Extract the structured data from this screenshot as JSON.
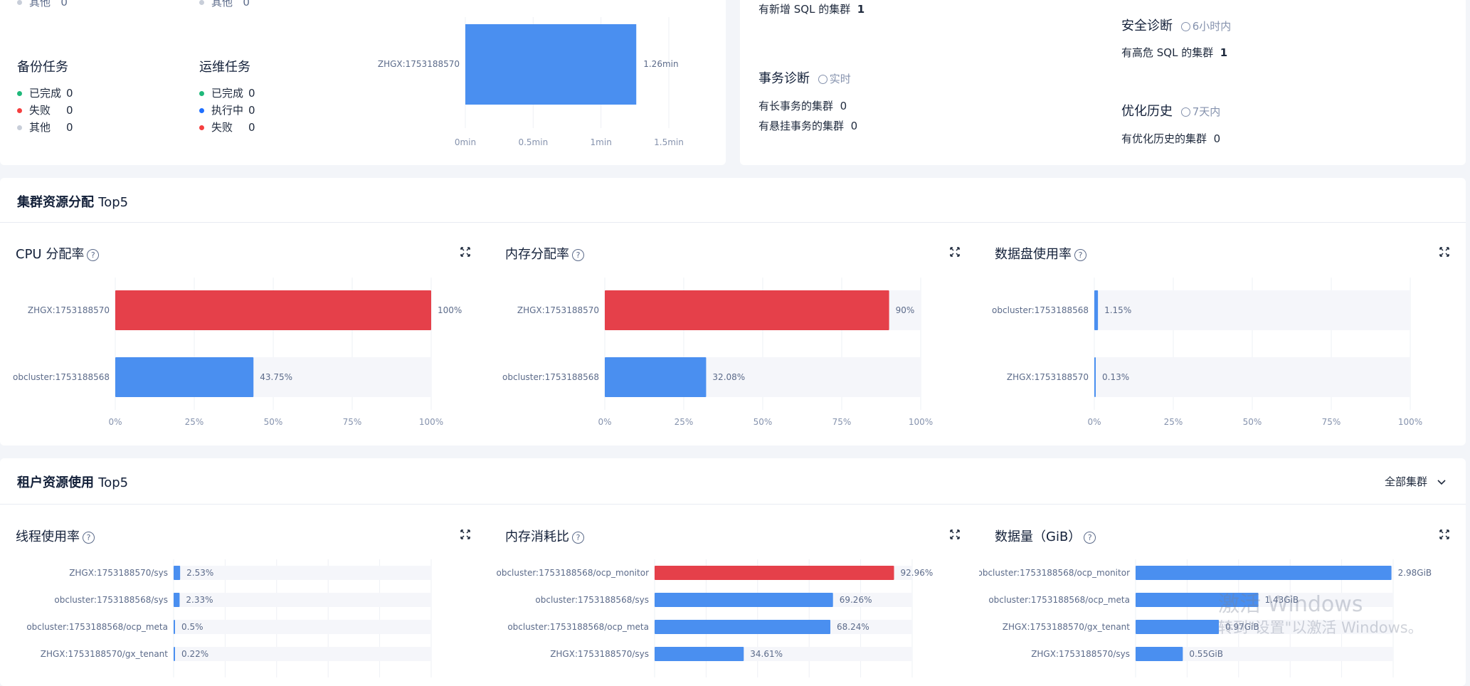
{
  "top_left": {
    "backup": {
      "title": "备份任务",
      "items": [
        {
          "label": "已完成",
          "value": "0",
          "color": "#1fb87a"
        },
        {
          "label": "失败",
          "value": "0",
          "color": "#f53f3f"
        },
        {
          "label": "其他",
          "value": "0",
          "color": "#c8ced9"
        }
      ]
    },
    "ops": {
      "title": "运维任务",
      "items": [
        {
          "label": "已完成",
          "value": "0",
          "color": "#1fb87a"
        },
        {
          "label": "执行中",
          "value": "0",
          "color": "#1f6fff"
        },
        {
          "label": "失败",
          "value": "0",
          "color": "#f53f3f"
        }
      ]
    },
    "cut_top": [
      {
        "label": "其他",
        "value": "0"
      },
      {
        "label": "其他",
        "value": "0"
      }
    ],
    "duration_chart": {
      "category": "ZHGX:1753188570",
      "value_label": "1.26min",
      "ticks": [
        "0min",
        "0.5min",
        "1min",
        "1.5min"
      ]
    }
  },
  "top_right": {
    "new_sql": {
      "label": "有新增 SQL 的集群",
      "value": "1"
    },
    "security": {
      "title": "安全诊断",
      "time": "6小时内",
      "label": "有高危 SQL 的集群",
      "value": "1"
    },
    "transaction": {
      "title": "事务诊断",
      "time": "实时",
      "items": [
        {
          "label": "有长事务的集群",
          "value": "0"
        },
        {
          "label": "有悬挂事务的集群",
          "value": "0"
        }
      ]
    },
    "optimize": {
      "title": "优化历史",
      "time": "7天内",
      "label": "有优化历史的集群",
      "value": "0"
    }
  },
  "cluster_section": {
    "title_bold": "集群资源分配",
    "title_thin": "Top5"
  },
  "tenant_section": {
    "title_bold": "租户资源使用",
    "title_thin": "Top5",
    "filter": "全部集群"
  },
  "colors": {
    "red": "#e5404a",
    "blue": "#4a8ff0",
    "track": "#f5f6fa"
  },
  "cluster_charts": [
    {
      "title": "CPU 分配率",
      "ticks": [
        "0%",
        "25%",
        "50%",
        "75%",
        "100%"
      ]
    },
    {
      "title": "内存分配率",
      "ticks": [
        "0%",
        "25%",
        "50%",
        "75%",
        "100%"
      ]
    },
    {
      "title": "数据盘使用率",
      "ticks": [
        "0%",
        "25%",
        "50%",
        "75%",
        "100%"
      ]
    }
  ],
  "tenant_charts": [
    {
      "title": "线程使用率"
    },
    {
      "title": "内存消耗比"
    },
    {
      "title": "数据量（GiB）"
    }
  ],
  "chart_data": [
    {
      "type": "bar",
      "orientation": "horizontal",
      "categories": [
        "ZHGX:1753188570"
      ],
      "values": [
        1.26
      ],
      "xlim": [
        0,
        1.5
      ]
    },
    {
      "type": "bar",
      "orientation": "horizontal",
      "title": "CPU 分配率",
      "categories": [
        "ZHGX:1753188570",
        "obcluster:1753188568"
      ],
      "values": [
        100,
        43.75
      ],
      "labels": [
        "100%",
        "43.75%"
      ],
      "xlim": [
        0,
        100
      ]
    },
    {
      "type": "bar",
      "orientation": "horizontal",
      "title": "内存分配率",
      "categories": [
        "ZHGX:1753188570",
        "obcluster:1753188568"
      ],
      "values": [
        90,
        32.08
      ],
      "labels": [
        "90%",
        "32.08%"
      ],
      "xlim": [
        0,
        100
      ]
    },
    {
      "type": "bar",
      "orientation": "horizontal",
      "title": "数据盘使用率",
      "categories": [
        "obcluster:1753188568",
        "ZHGX:1753188570"
      ],
      "values": [
        1.15,
        0.13
      ],
      "labels": [
        "1.15%",
        "0.13%"
      ],
      "xlim": [
        0,
        100
      ]
    },
    {
      "type": "bar",
      "orientation": "horizontal",
      "title": "线程使用率",
      "categories": [
        "ZHGX:1753188570/sys",
        "obcluster:1753188568/sys",
        "obcluster:1753188568/ocp_meta",
        "ZHGX:1753188570/gx_tenant"
      ],
      "values": [
        2.53,
        2.33,
        0.5,
        0.22
      ],
      "labels": [
        "2.53%",
        "2.33%",
        "0.5%",
        "0.22%"
      ],
      "xlim": [
        0,
        100
      ]
    },
    {
      "type": "bar",
      "orientation": "horizontal",
      "title": "内存消耗比",
      "categories": [
        "obcluster:1753188568/ocp_monitor",
        "obcluster:1753188568/sys",
        "obcluster:1753188568/ocp_meta",
        "ZHGX:1753188570/sys"
      ],
      "values": [
        92.96,
        69.26,
        68.24,
        34.61
      ],
      "labels": [
        "92.96%",
        "69.26%",
        "68.24%",
        "34.61%"
      ],
      "xlim": [
        0,
        100
      ]
    },
    {
      "type": "bar",
      "orientation": "horizontal",
      "title": "数据量（GiB）",
      "categories": [
        "obcluster:1753188568/ocp_monitor",
        "obcluster:1753188568/ocp_meta",
        "ZHGX:1753188570/gx_tenant",
        "ZHGX:1753188570/sys"
      ],
      "values": [
        2.98,
        1.43,
        0.97,
        0.55
      ],
      "labels": [
        "2.98GiB",
        "1.43GiB",
        "0.97GiB",
        "0.55GiB"
      ],
      "xlim": [
        0,
        3
      ]
    }
  ],
  "watermark": {
    "line1": "激活 Windows",
    "line2": "转到\"设置\"以激活 Windows。"
  }
}
